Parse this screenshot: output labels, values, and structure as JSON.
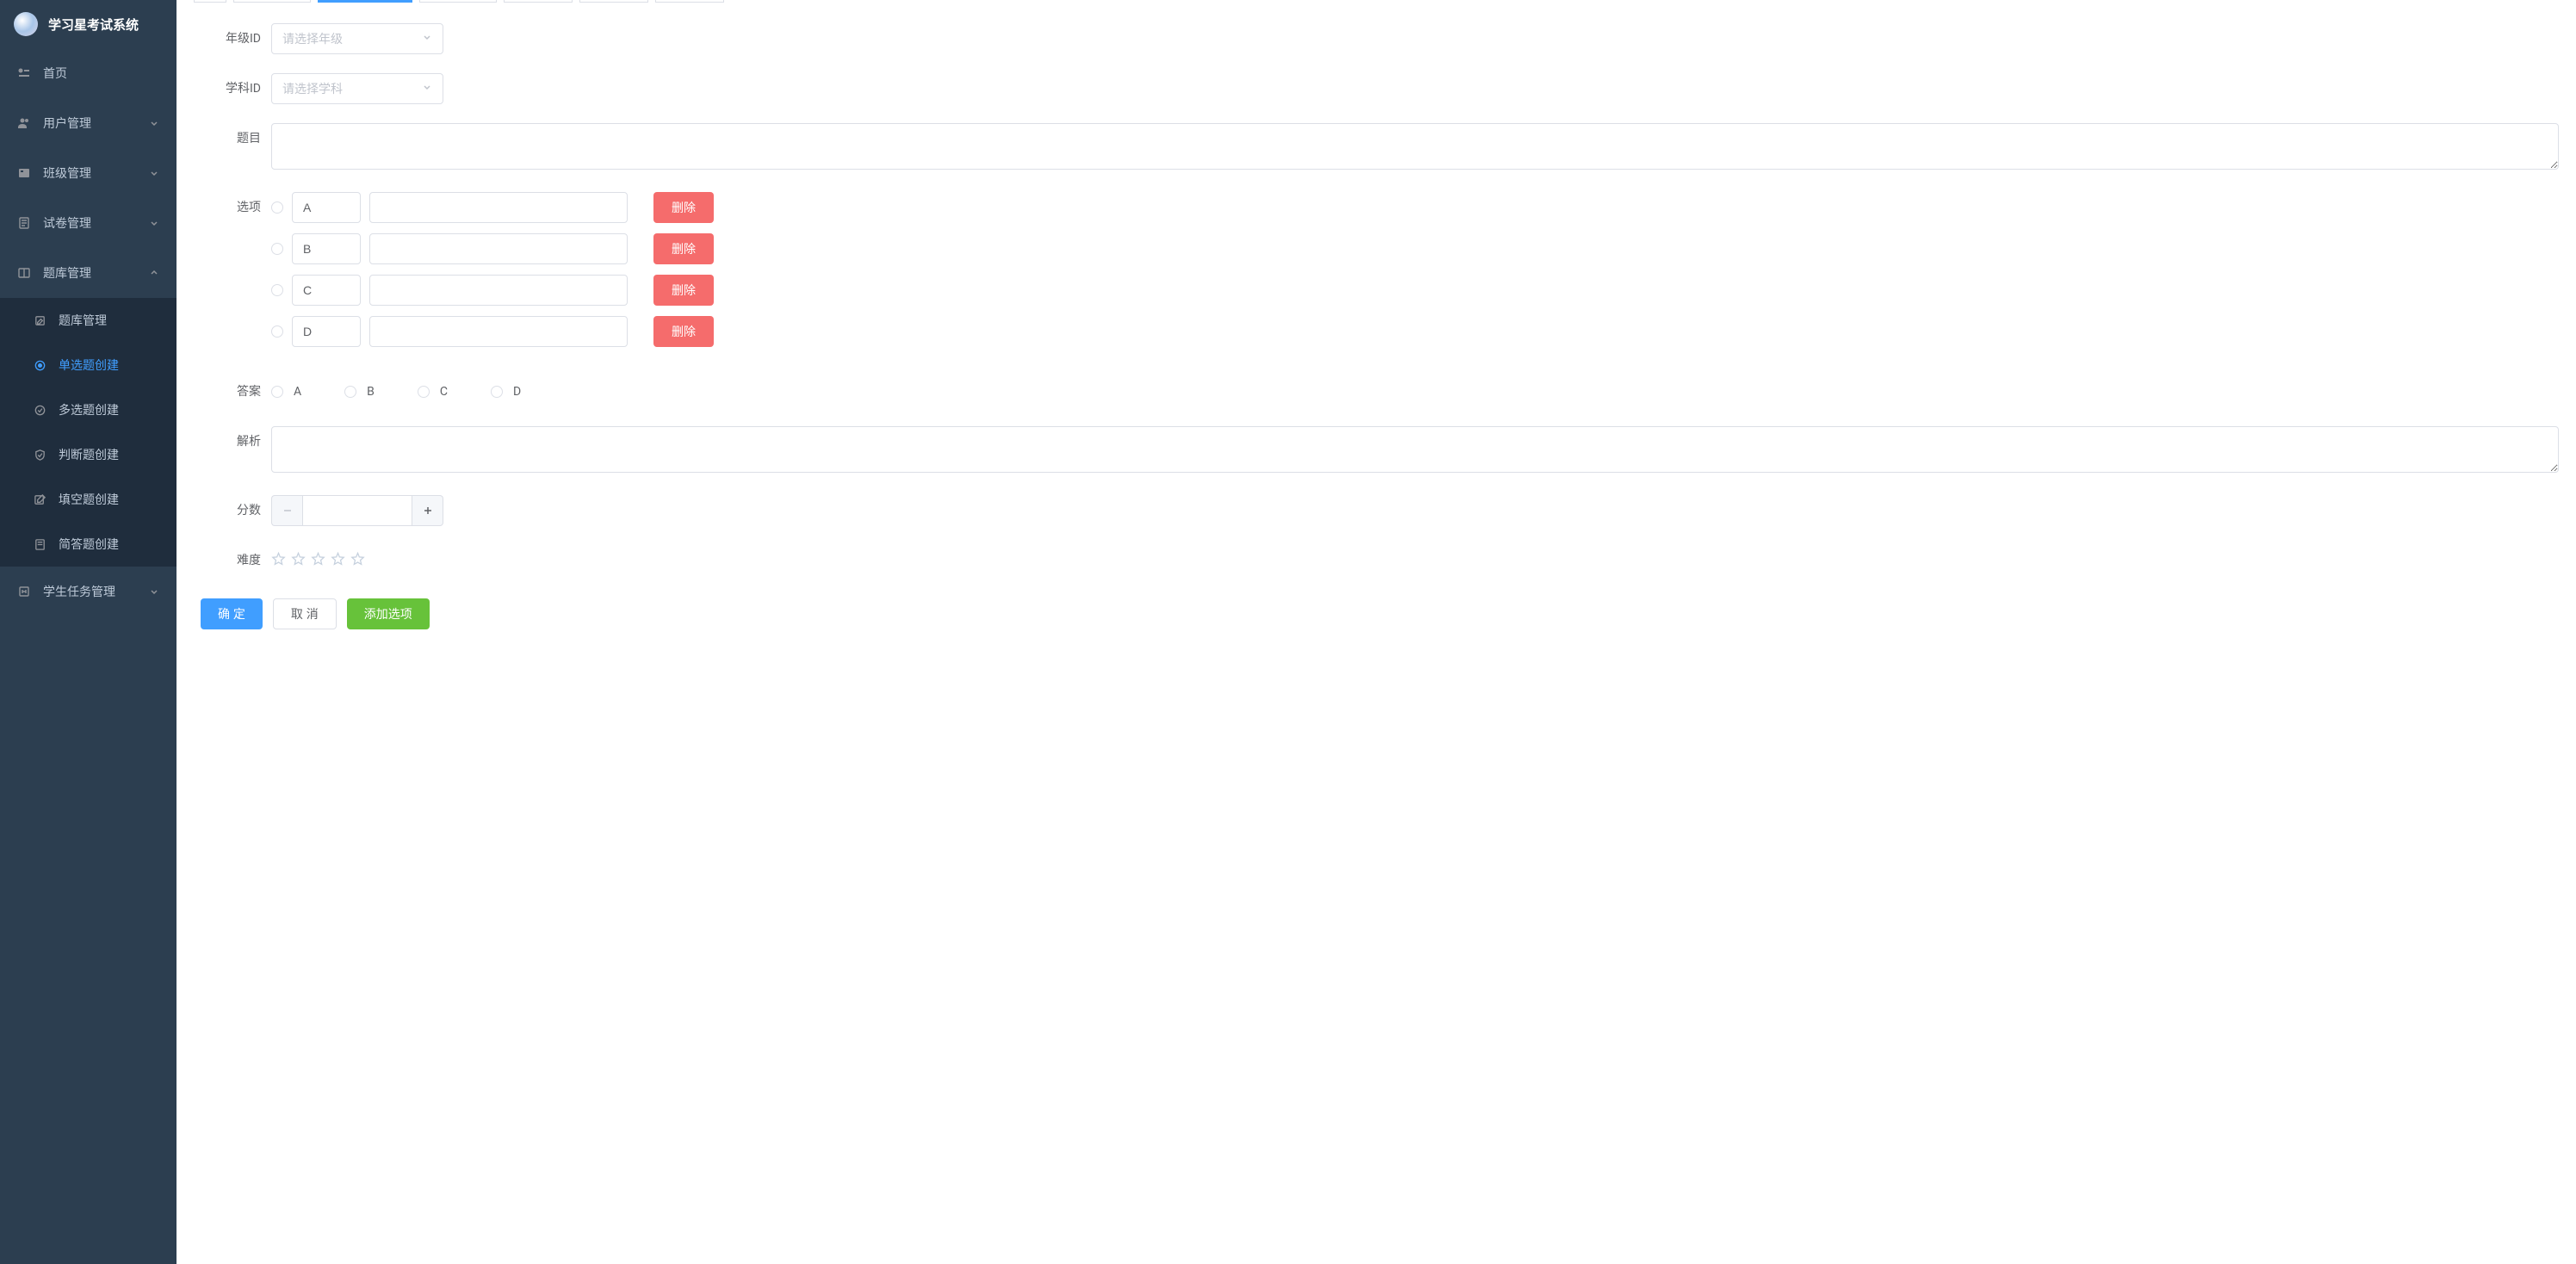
{
  "brand": "学习星考试系统",
  "sidebar": {
    "items": [
      {
        "label": "首页",
        "icon": "dashboard"
      },
      {
        "label": "用户管理",
        "icon": "users",
        "hasChildren": true
      },
      {
        "label": "班级管理",
        "icon": "class",
        "hasChildren": true
      },
      {
        "label": "试卷管理",
        "icon": "paper",
        "hasChildren": true
      },
      {
        "label": "题库管理",
        "icon": "book",
        "hasChildren": true,
        "expanded": true,
        "children": [
          {
            "label": "题库管理",
            "icon": "edit"
          },
          {
            "label": "单选题创建",
            "icon": "radio",
            "active": true
          },
          {
            "label": "多选题创建",
            "icon": "checkbox"
          },
          {
            "label": "判断题创建",
            "icon": "judge"
          },
          {
            "label": "填空题创建",
            "icon": "fill"
          },
          {
            "label": "简答题创建",
            "icon": "short"
          }
        ]
      },
      {
        "label": "学生任务管理",
        "icon": "task",
        "hasChildren": true
      }
    ]
  },
  "form": {
    "gradeId": {
      "label": "年级ID",
      "placeholder": "请选择年级"
    },
    "subjectId": {
      "label": "学科ID",
      "placeholder": "请选择学科"
    },
    "question": {
      "label": "题目"
    },
    "options": {
      "label": "选项",
      "rows": [
        {
          "letter": "A",
          "text": ""
        },
        {
          "letter": "B",
          "text": ""
        },
        {
          "letter": "C",
          "text": ""
        },
        {
          "letter": "D",
          "text": ""
        }
      ],
      "deleteLabel": "删除"
    },
    "answer": {
      "label": "答案",
      "choices": [
        "A",
        "B",
        "C",
        "D"
      ]
    },
    "analysis": {
      "label": "解析"
    },
    "score": {
      "label": "分数"
    },
    "difficulty": {
      "label": "难度",
      "stars": 5
    }
  },
  "actions": {
    "confirm": "确 定",
    "cancel": "取 消",
    "addOption": "添加选项"
  }
}
